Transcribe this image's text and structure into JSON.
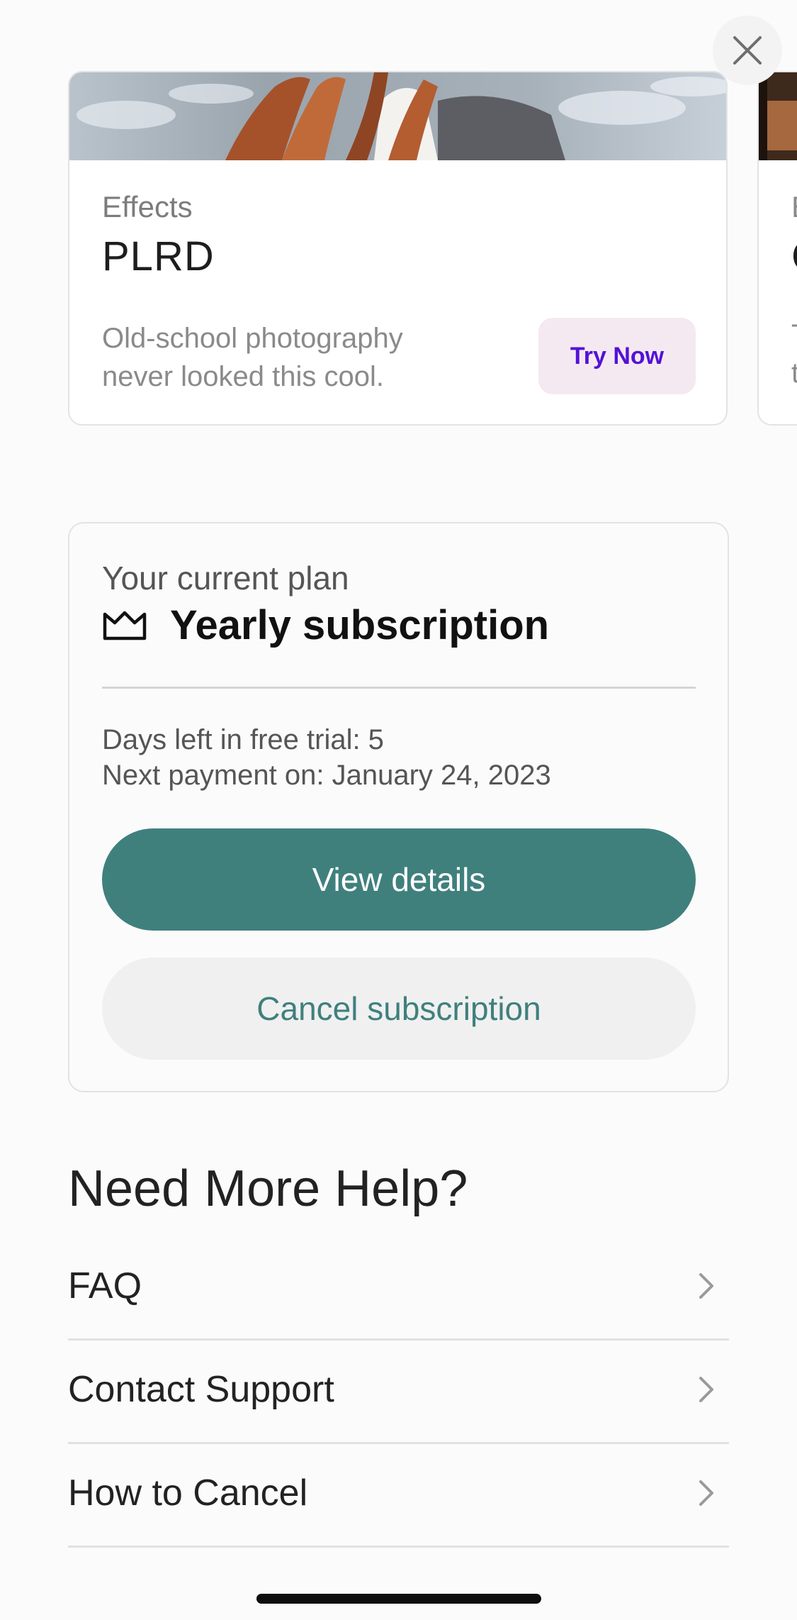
{
  "close": {
    "icon": "close-icon"
  },
  "effects_card": {
    "category": "Effects",
    "title": "PLRD",
    "description": "Old-school photography never looked this cool.",
    "cta": "Try Now"
  },
  "peek_card": {
    "category": "E",
    "title": "C",
    "desc_line1": "T",
    "desc_line2": "t"
  },
  "plan": {
    "label": "Your current plan",
    "icon": "crown-icon",
    "name": "Yearly subscription",
    "trial_days": "Days left in free trial: 5",
    "next_payment": "Next payment on: January 24, 2023",
    "view_details": "View details",
    "cancel": "Cancel subscription"
  },
  "help": {
    "title": "Need More Help?",
    "items": [
      {
        "label": "FAQ"
      },
      {
        "label": "Contact Support"
      },
      {
        "label": "How to Cancel"
      }
    ]
  },
  "colors": {
    "accent": "#3f807d",
    "try_now_text": "#5312d6",
    "try_now_bg": "#f5e9f1"
  }
}
